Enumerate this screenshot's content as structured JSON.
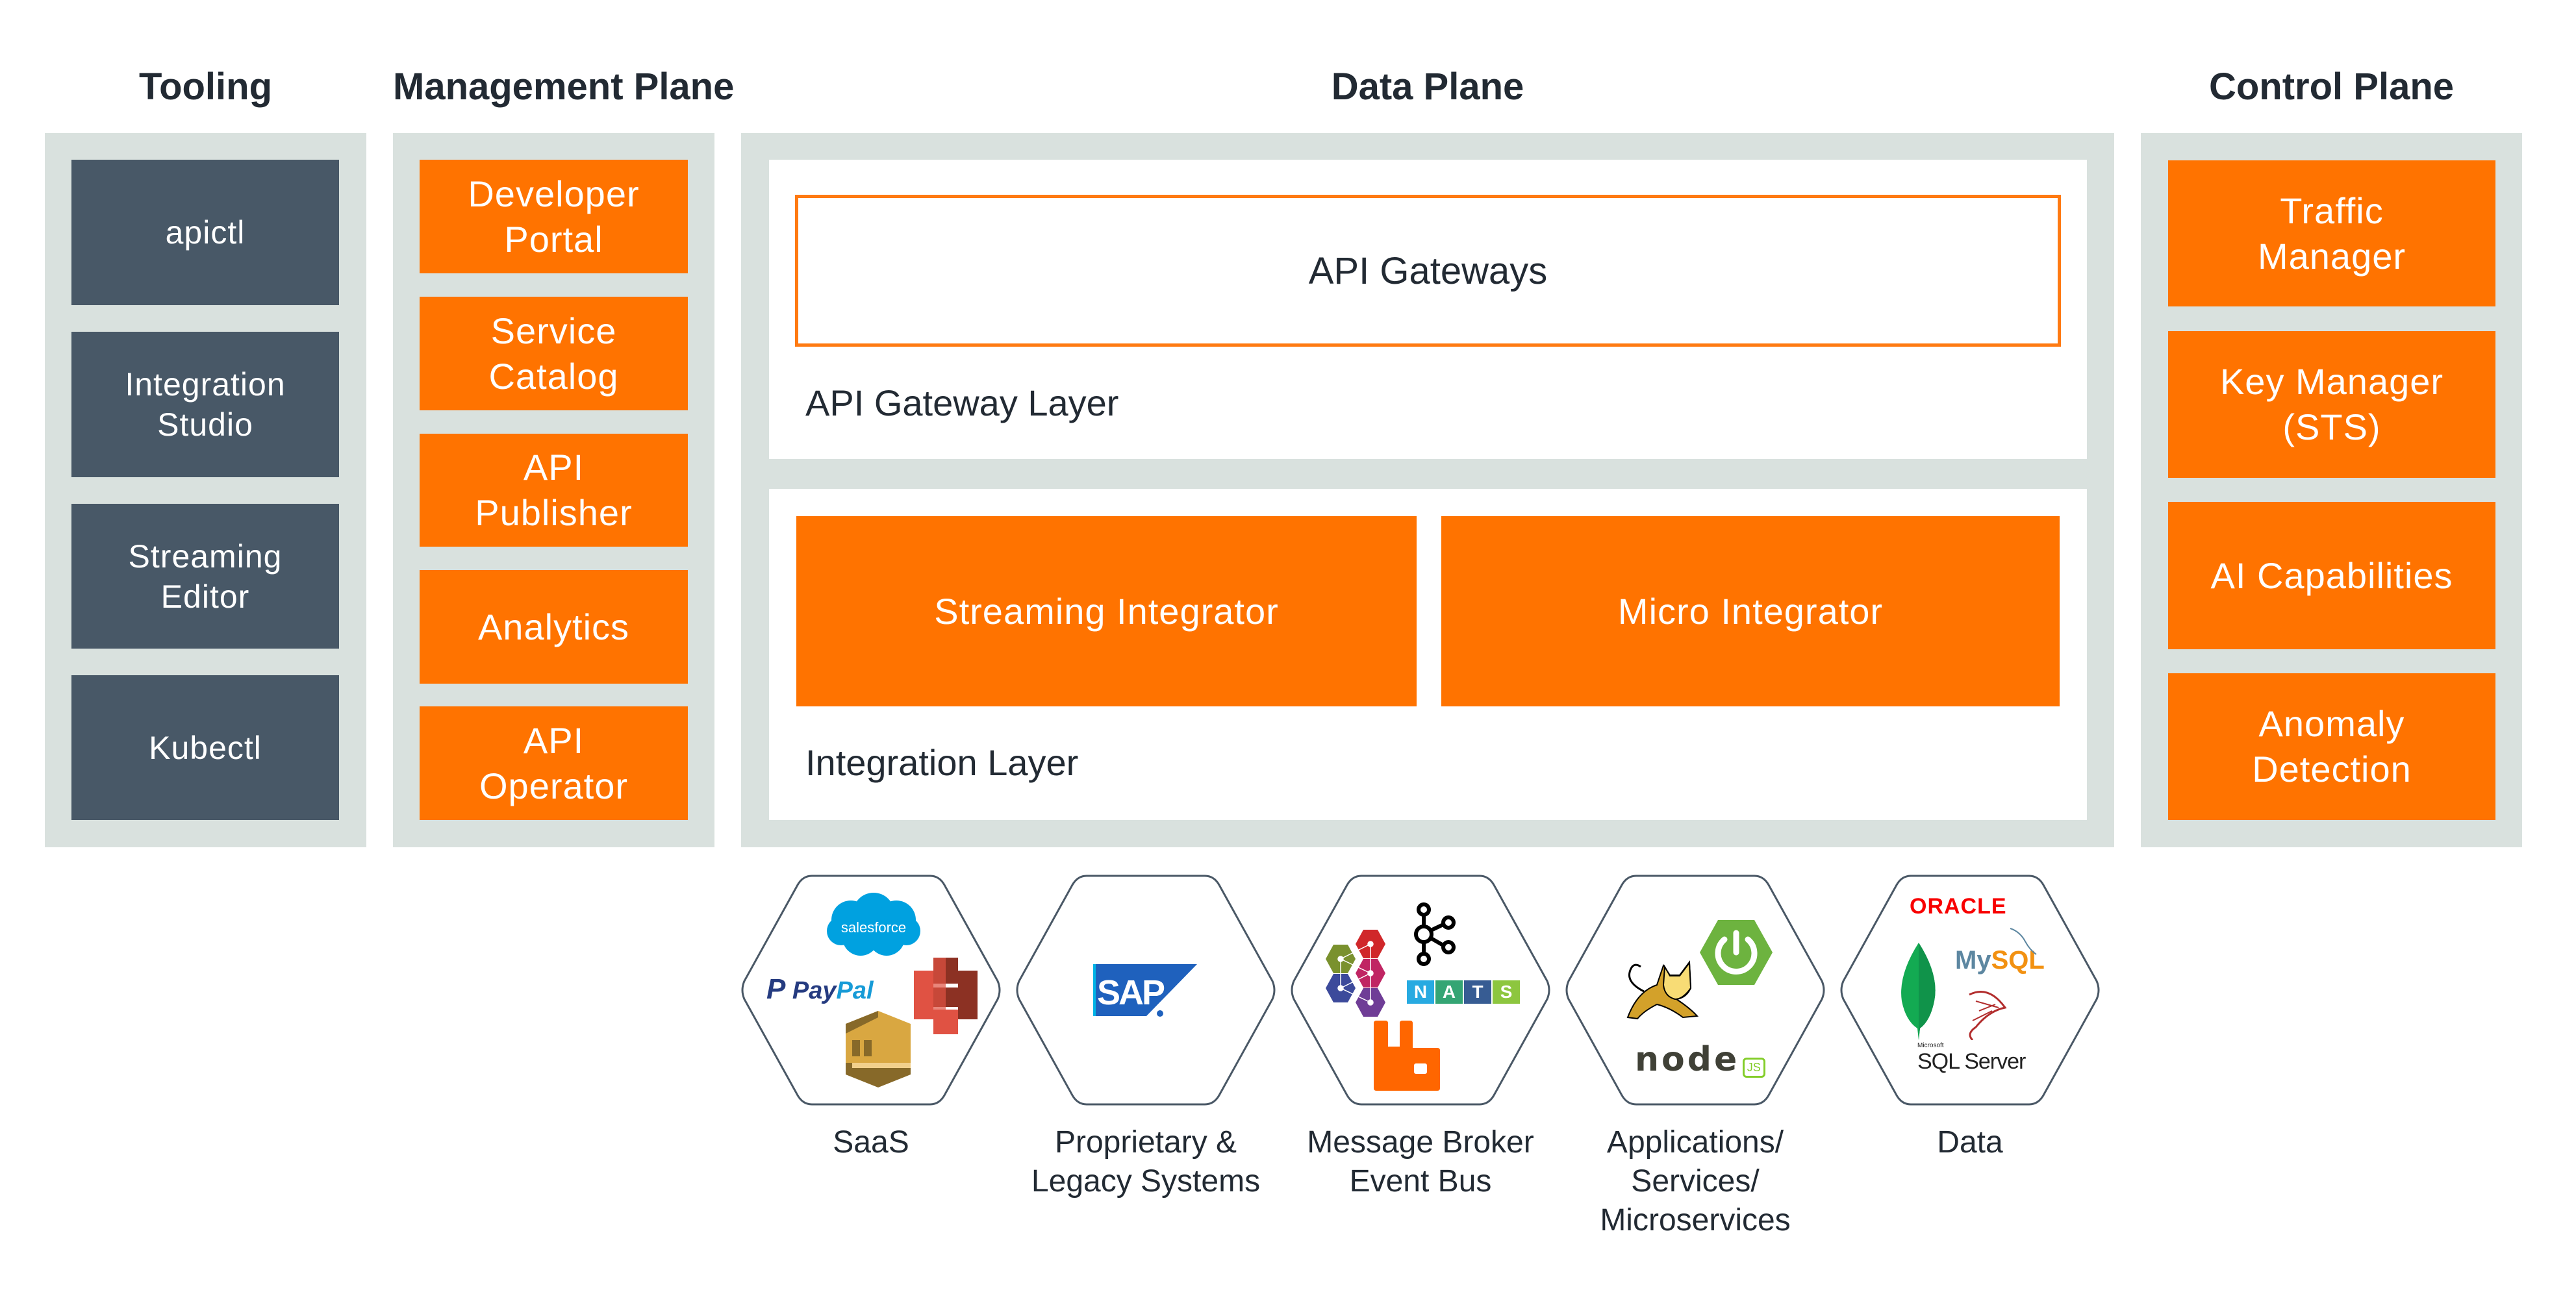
{
  "headings": {
    "tooling": "Tooling",
    "management": "Management Plane",
    "data": "Data Plane",
    "control": "Control Plane"
  },
  "tooling": {
    "items": [
      "apictl",
      "Integration\nStudio",
      "Streaming\nEditor",
      "Kubectl"
    ]
  },
  "management": {
    "items": [
      "Developer\nPortal",
      "Service\nCatalog",
      "API\nPublisher",
      "Analytics",
      "API\nOperator"
    ]
  },
  "data_plane": {
    "gateway_box": "API Gateways",
    "gateway_layer_label": "API Gateway Layer",
    "integration_items": [
      "Streaming Integrator",
      "Micro Integrator"
    ],
    "integration_layer_label": "Integration Layer"
  },
  "control": {
    "items": [
      "Traffic\nManager",
      "Key Manager\n(STS)",
      "AI Capabilities",
      "Anomaly\nDetection"
    ]
  },
  "endpoints": [
    {
      "label": "SaaS",
      "logos": [
        "salesforce-logo",
        "paypal-logo",
        "aws-s3-icon",
        "aws-sqs-icon"
      ]
    },
    {
      "label": "Proprietary &\nLegacy Systems",
      "logos": [
        "sap-logo"
      ]
    },
    {
      "label": "Message Broker\nEvent Bus",
      "logos": [
        "hexagon-cluster-logo",
        "kafka-logo",
        "nats-logo",
        "rabbitmq-logo"
      ]
    },
    {
      "label": "Applications/\nServices/\nMicroservices",
      "logos": [
        "tomcat-logo",
        "spring-boot-logo",
        "nodejs-logo"
      ]
    },
    {
      "label": "Data",
      "logos": [
        "oracle-logo",
        "mongodb-logo",
        "mysql-logo",
        "sql-server-logo"
      ]
    }
  ],
  "logo_text": {
    "salesforce": "salesforce",
    "paypal_dark": "Pay",
    "paypal_light": "Pal",
    "sap": "SAP",
    "nats": [
      "N",
      "A",
      "T",
      "S"
    ],
    "node": "node",
    "js": "JS",
    "oracle": "ORACLE",
    "mysql_my": "My",
    "mysql_sql": "SQL",
    "microsoft": "Microsoft",
    "sqlserver": "SQL Server"
  },
  "colors": {
    "orange": "#ff7300",
    "dark_box": "#485867",
    "panel": "#d9e1de",
    "text": "#222a33"
  }
}
